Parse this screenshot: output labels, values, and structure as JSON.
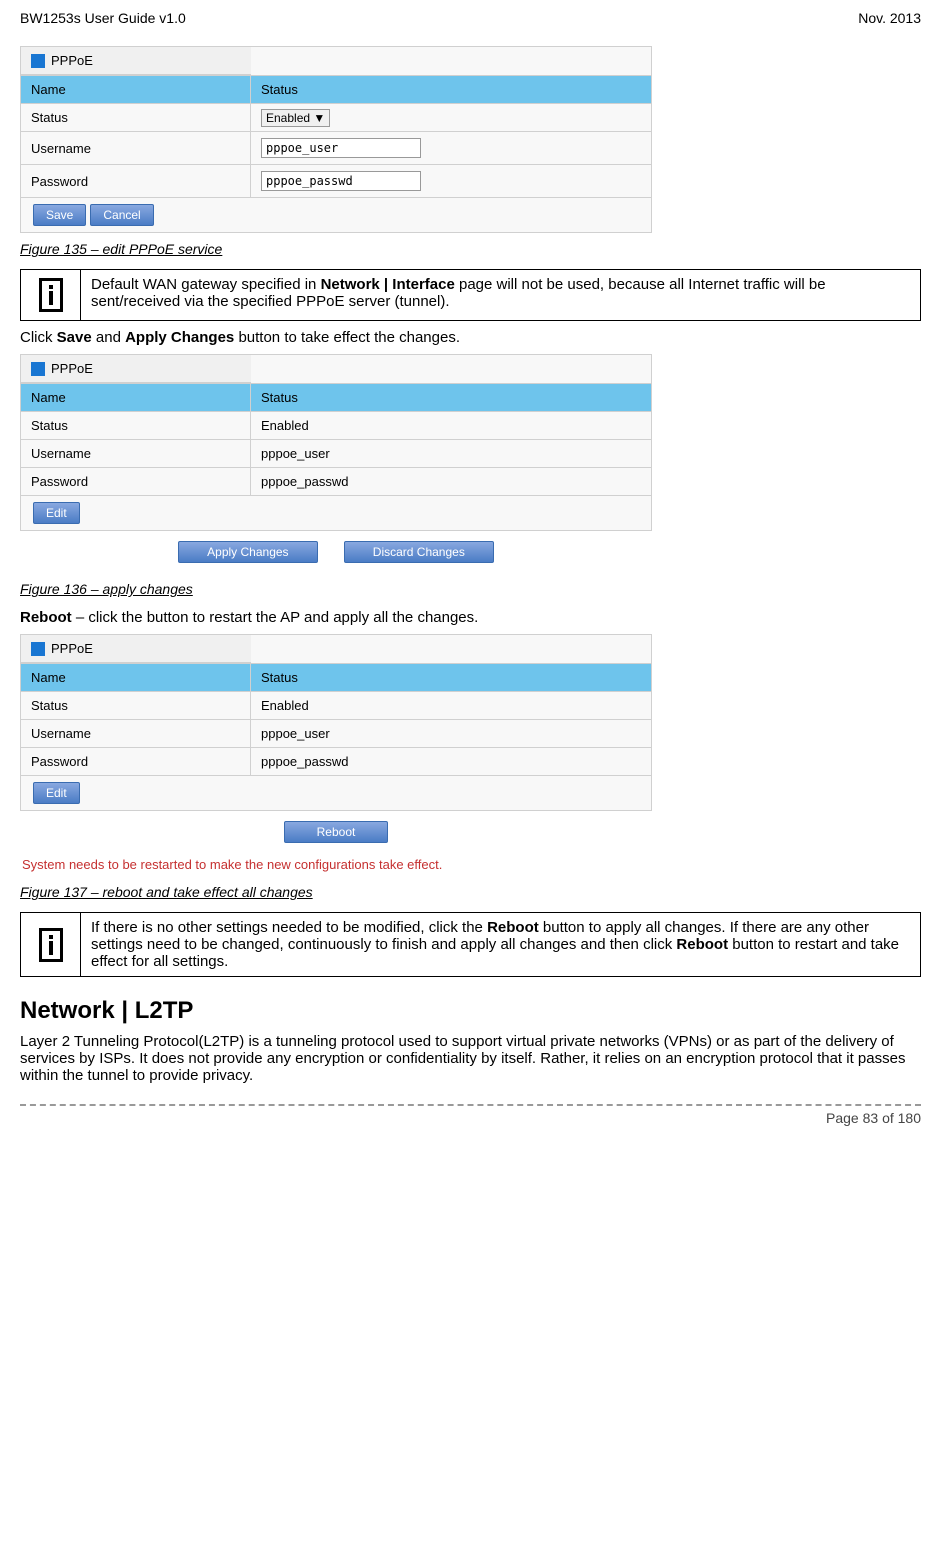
{
  "header": {
    "left": "BW1253s User Guide v1.0",
    "right": "Nov.  2013"
  },
  "pppoe_title": "PPPoE",
  "cols": {
    "name": "Name",
    "status": "Status"
  },
  "rows": {
    "status": "Status",
    "username": "Username",
    "password": "Password",
    "status_val_enabled": "Enabled",
    "username_val": "pppoe_user",
    "password_val": "pppoe_passwd"
  },
  "buttons": {
    "save": "Save",
    "cancel": "Cancel",
    "edit": "Edit",
    "apply": "Apply Changes",
    "discard": "Discard Changes",
    "reboot": "Reboot"
  },
  "select_option": "Enabled",
  "fig135": "Figure 135 – edit PPPoE service",
  "info1": {
    "pre": "Default WAN gateway specified in ",
    "b1": "Network | Interface",
    "post": " page will not be used, because all Internet traffic will be sent/received via the specified PPPoE server (tunnel)."
  },
  "body1": {
    "pre": "Click ",
    "b1": "Save",
    "mid": " and ",
    "b2": "Apply Changes",
    "post": " button to take effect the changes."
  },
  "fig136": "Figure 136 – apply changes",
  "body2": {
    "b1": "Reboot",
    "post": " – click the button to restart the AP and apply all the changes."
  },
  "reboot_msg": "System needs to be restarted to make the new configurations take effect.",
  "fig137": "Figure 137 – reboot and take effect all changes",
  "info2": {
    "pre": "If there is no other settings needed to be modified, click the ",
    "b1": "Reboot",
    "mid1": " button to apply all changes. If there are any other settings need to be changed, continuously to finish and apply all changes and then click ",
    "b2": "Reboot",
    "post": " button to restart and take effect  for all settings."
  },
  "section_l2tp": "Network | L2TP",
  "l2tp_body": "Layer 2 Tunneling Protocol(L2TP) is a tunneling protocol used to support virtual private networks (VPNs) or as part of the delivery of services by ISPs. It does not provide any encryption or confidentiality by itself. Rather, it relies on an encryption protocol that it passes within the tunnel to provide privacy.",
  "footer": "Page 83 of 180"
}
